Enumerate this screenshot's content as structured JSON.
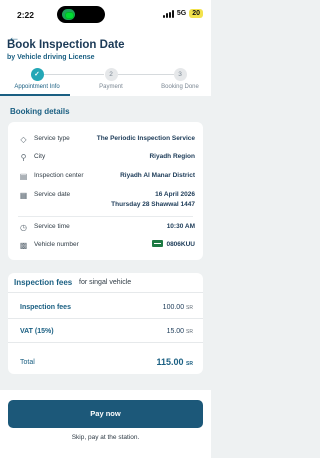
{
  "status_bar": {
    "time": "2:22",
    "network": "5G",
    "battery": "20"
  },
  "header": {
    "title": "Book Inspection Date",
    "subtitle": "by Vehicle driving License"
  },
  "stepper": {
    "steps": [
      {
        "number": "✓",
        "label": "Appointment Info",
        "state": "done"
      },
      {
        "number": "2",
        "label": "Payment",
        "state": "todo"
      },
      {
        "number": "3",
        "label": "Booking Done",
        "state": "todo"
      }
    ]
  },
  "booking": {
    "section_title": "Booking details",
    "service_type": {
      "label": "Service type",
      "value": "The Periodic Inspection Service",
      "icon": "tag-icon"
    },
    "city": {
      "label": "City",
      "value": "Riyadh Region",
      "icon": "location-pin-icon"
    },
    "inspection_center": {
      "label": "Inspection center",
      "value": "Riyadh Al Manar District",
      "icon": "car-center-icon"
    },
    "service_date": {
      "label": "Service date",
      "value": "16 April 2026",
      "value2": "Thursday 28 Shawwal 1447",
      "icon": "calendar-icon"
    },
    "service_time": {
      "label": "Service time",
      "value": "10:30   AM",
      "icon": "clock-icon"
    },
    "vehicle_number": {
      "label": "Vehicle number",
      "value": "0806KUU",
      "icon": "car-icon"
    }
  },
  "fees": {
    "title": "Inspection fees",
    "subtitle": "for singal vehicle",
    "inspection_fees": {
      "label": "Inspection fees",
      "amount": "100.00",
      "currency": "SR"
    },
    "vat": {
      "label": "VAT (15%)",
      "amount": "15.00",
      "currency": "SR"
    },
    "total": {
      "label": "Total",
      "amount": "115.00",
      "currency": "SR"
    }
  },
  "actions": {
    "pay_now": "Pay now",
    "skip": "Skip, pay at the station."
  },
  "colors": {
    "primary": "#1c5879",
    "accent": "#24a7b6",
    "text": "#1b3a57"
  }
}
